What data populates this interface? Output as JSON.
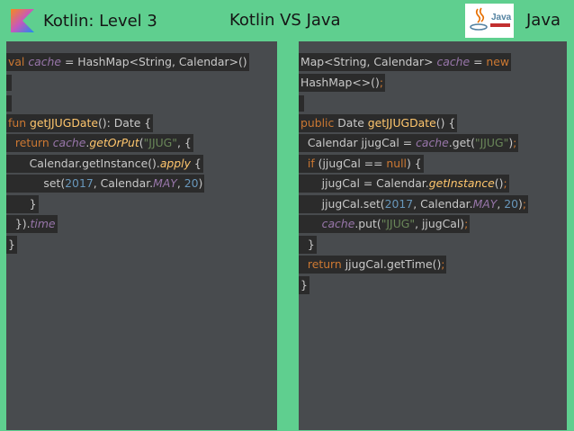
{
  "header": {
    "left_title": "Kotlin: Level 3",
    "center_title": "Kotlin VS Java",
    "right_title": "Java",
    "java_logo_text": "Java"
  },
  "colors": {
    "background": "#5fcf8f",
    "panel": "#484b4e",
    "code_highlight": "#2b2b2b",
    "keyword": "#cc7832",
    "function": "#ffc66d",
    "property": "#9876aa",
    "string": "#6a8759",
    "number": "#6897bb",
    "plain": "#c9c9c9"
  },
  "kotlin_code": [
    [
      [
        "kw",
        "val "
      ],
      [
        "it",
        "cache"
      ],
      [
        "id",
        " = HashMap<String, Calendar>()"
      ]
    ],
    [],
    [],
    [
      [
        "kw",
        "fun "
      ],
      [
        "fn",
        "getJJUGDate"
      ],
      [
        "id",
        "(): Date {"
      ]
    ],
    [
      [
        "id",
        "  "
      ],
      [
        "kw",
        "return "
      ],
      [
        "it",
        "cache"
      ],
      [
        "id",
        "."
      ],
      [
        "ifn",
        "getOrPut"
      ],
      [
        "id",
        "("
      ],
      [
        "str",
        "\"JJUG\""
      ],
      [
        "id",
        ", {"
      ]
    ],
    [
      [
        "id",
        "      Calendar.getInstance()."
      ],
      [
        "ifn",
        "apply"
      ],
      [
        "id",
        " {"
      ]
    ],
    [
      [
        "id",
        "          set("
      ],
      [
        "num",
        "2017"
      ],
      [
        "id",
        ", Calendar."
      ],
      [
        "it",
        "MAY"
      ],
      [
        "id",
        ", "
      ],
      [
        "num",
        "20"
      ],
      [
        "id",
        ")"
      ]
    ],
    [
      [
        "id",
        "      }"
      ]
    ],
    [
      [
        "id",
        "  })."
      ],
      [
        "it",
        "time"
      ]
    ],
    [
      [
        "id",
        "}"
      ]
    ]
  ],
  "java_code": [
    [
      [
        "id",
        "Map<String, Calendar> "
      ],
      [
        "it",
        "cache"
      ],
      [
        "id",
        " = "
      ],
      [
        "kw",
        "new"
      ]
    ],
    [
      [
        "id",
        "HashMap<>()"
      ],
      [
        "kw",
        ";"
      ]
    ],
    [],
    [
      [
        "kw",
        "public "
      ],
      [
        "id",
        "Date "
      ],
      [
        "fn",
        "getJJUGDate"
      ],
      [
        "id",
        "() {"
      ]
    ],
    [
      [
        "id",
        "  Calendar jjugCal = "
      ],
      [
        "it",
        "cache"
      ],
      [
        "id",
        ".get("
      ],
      [
        "str",
        "\"JJUG\""
      ],
      [
        "id",
        ")"
      ],
      [
        "kw",
        ";"
      ]
    ],
    [
      [
        "id",
        "  "
      ],
      [
        "kw",
        "if "
      ],
      [
        "id",
        "(jjugCal == "
      ],
      [
        "kw",
        "null"
      ],
      [
        "id",
        ") {"
      ]
    ],
    [
      [
        "id",
        "      jjugCal = Calendar."
      ],
      [
        "ifn",
        "getInstance"
      ],
      [
        "id",
        "()"
      ],
      [
        "kw",
        ";"
      ]
    ],
    [
      [
        "id",
        "      jjugCal.set("
      ],
      [
        "num",
        "2017"
      ],
      [
        "id",
        ", Calendar."
      ],
      [
        "it",
        "MAY"
      ],
      [
        "id",
        ", "
      ],
      [
        "num",
        "20"
      ],
      [
        "id",
        ")"
      ],
      [
        "kw",
        ";"
      ]
    ],
    [
      [
        "id",
        "      "
      ],
      [
        "it",
        "cache"
      ],
      [
        "id",
        ".put("
      ],
      [
        "str",
        "\"JJUG\""
      ],
      [
        "id",
        ", jjugCal)"
      ],
      [
        "kw",
        ";"
      ]
    ],
    [
      [
        "id",
        "  }"
      ]
    ],
    [
      [
        "id",
        "  "
      ],
      [
        "kw",
        "return "
      ],
      [
        "id",
        "jjugCal.getTime()"
      ],
      [
        "kw",
        ";"
      ]
    ],
    [
      [
        "id",
        "}"
      ]
    ]
  ]
}
